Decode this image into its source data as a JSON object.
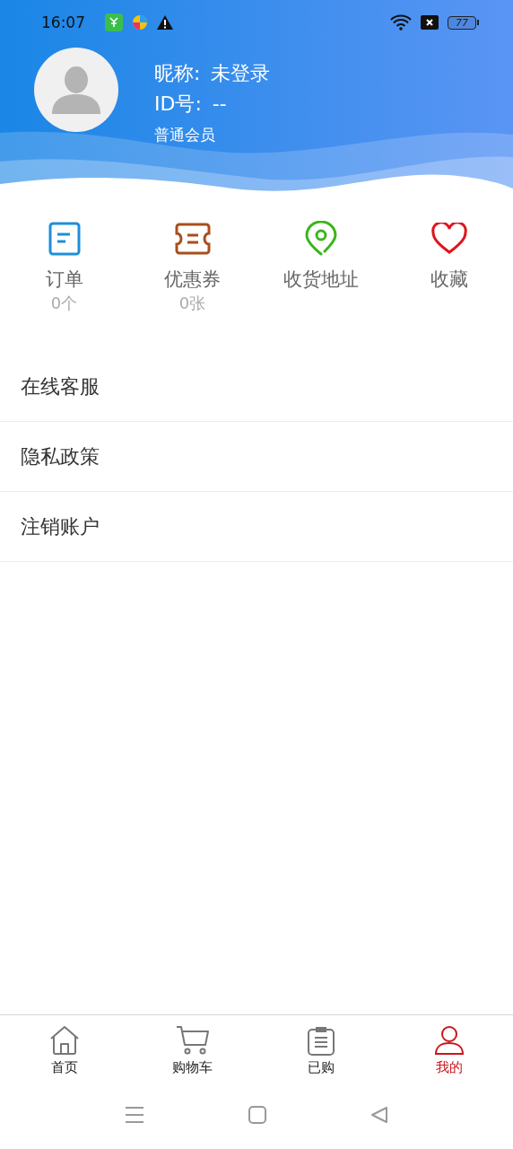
{
  "status_bar": {
    "time": "16:07",
    "battery": "77"
  },
  "profile": {
    "nickname_label": "昵称:",
    "nickname": "未登录",
    "id_label": "ID号:",
    "id": "--",
    "membership": "普通会员"
  },
  "shortcuts": [
    {
      "label": "订单",
      "count": "0个",
      "color": "#1e8fd8"
    },
    {
      "label": "优惠券",
      "count": "0张",
      "color": "#a84f1c"
    },
    {
      "label": "收货地址",
      "color": "#3ab51c"
    },
    {
      "label": "收藏",
      "color": "#e0141c"
    }
  ],
  "menu": [
    {
      "label": "在线客服"
    },
    {
      "label": "隐私政策"
    },
    {
      "label": "注销账户"
    }
  ],
  "tabs": [
    {
      "label": "首页",
      "selected": false
    },
    {
      "label": "购物车",
      "selected": false
    },
    {
      "label": "已购",
      "selected": false
    },
    {
      "label": "我的",
      "selected": true
    }
  ]
}
